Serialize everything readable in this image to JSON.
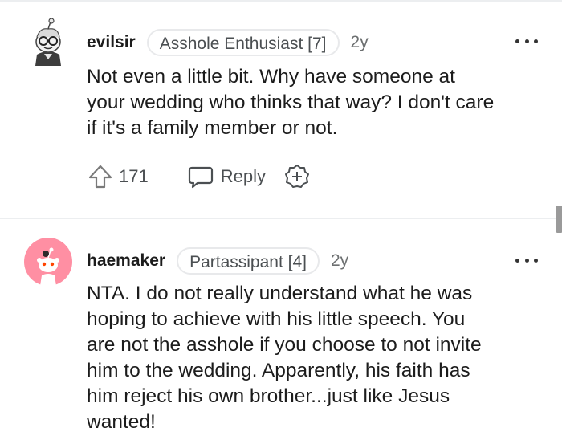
{
  "comments": [
    {
      "author": "evilsir",
      "flair": "Asshole Enthusiast [7]",
      "age": "2y",
      "body": "Not even a little bit. Why have someone at\nyour wedding who thinks that way? I don't care\nif it's a family member or not.",
      "score": "171",
      "reply_label": "Reply",
      "avatar_icon": "snoo-avatar-with-glasses-icon",
      "avatar_bg": "#ffffff"
    },
    {
      "author": "haemaker",
      "flair": "Partassipant [4]",
      "age": "2y",
      "body": "NTA. I do not really understand what he was\nhoping to achieve with his little speech. You\nare not the asshole if you choose to not invite\nhim to the wedding. Apparently, his faith has\nhim reject his own brother...just like Jesus\nwanted!",
      "avatar_icon": "default-snoo-avatar-icon",
      "avatar_bg": "#ff8fa3"
    }
  ],
  "colors": {
    "text": "#1c1c1c",
    "meta": "#6d7071",
    "divider": "#eceef0"
  }
}
